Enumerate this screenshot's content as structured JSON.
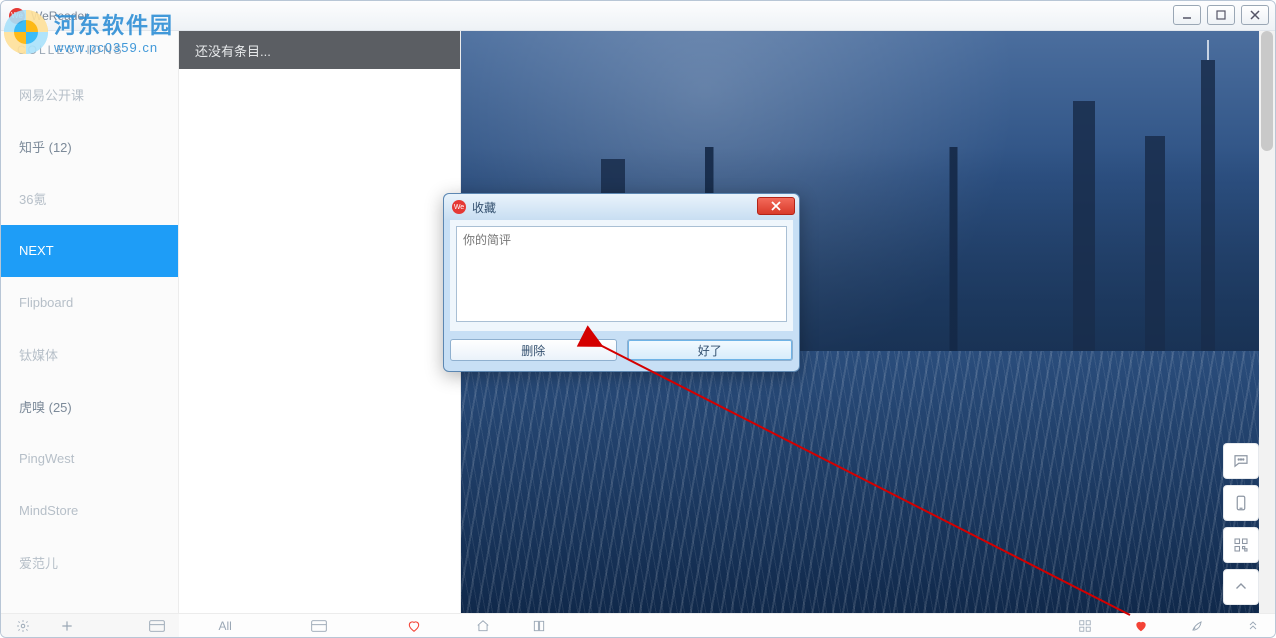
{
  "app": {
    "title": "WeReader"
  },
  "watermark": {
    "line1": "河东软件园",
    "line2": "www.pc0359.cn"
  },
  "sidebar": {
    "header": "Collections",
    "items": [
      {
        "label": "网易公开课",
        "dim": true
      },
      {
        "label": "知乎 (12)"
      },
      {
        "label": "36氪",
        "dim": true
      },
      {
        "label": "NEXT",
        "active": true
      },
      {
        "label": "Flipboard",
        "dim": true
      },
      {
        "label": "钛媒体",
        "dim": true
      },
      {
        "label": "虎嗅 (25)"
      },
      {
        "label": "PingWest",
        "dim": true
      },
      {
        "label": "MindStore",
        "dim": true
      },
      {
        "label": "爱范儿",
        "dim": true
      }
    ]
  },
  "list": {
    "header": "还没有条目..."
  },
  "bottom": {
    "mid_label": "All"
  },
  "dialog": {
    "title": "收藏",
    "placeholder": "你的简评",
    "delete": "删除",
    "ok": "好了"
  }
}
